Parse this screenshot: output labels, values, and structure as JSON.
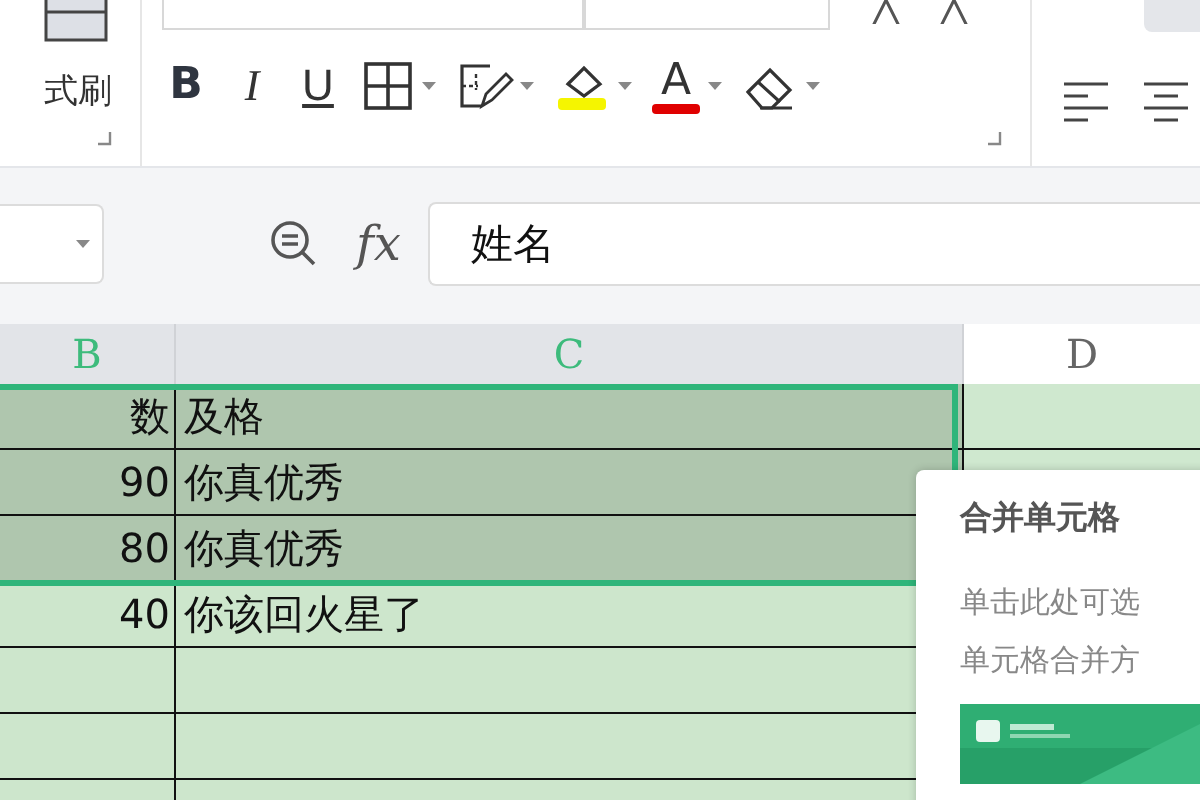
{
  "ribbon": {
    "format_painter": "式刷",
    "tools": [
      {
        "kind": "bold",
        "label": "B"
      },
      {
        "kind": "italic",
        "label": "I"
      },
      {
        "kind": "underline",
        "label": "U"
      },
      {
        "kind": "borders",
        "dropdown": true
      },
      {
        "kind": "cell-style",
        "dropdown": true
      },
      {
        "kind": "fill",
        "dropdown": true,
        "color": "#f5f500"
      },
      {
        "kind": "font-color",
        "label": "A",
        "dropdown": true,
        "color": "#e00000"
      },
      {
        "kind": "eraser",
        "dropdown": true
      },
      {
        "kind": "align-left"
      },
      {
        "kind": "align-center"
      }
    ]
  },
  "formula_bar": {
    "function_label": "fx",
    "value": "姓名"
  },
  "columns": [
    {
      "label": "B",
      "selected": true
    },
    {
      "label": "C",
      "selected": true
    },
    {
      "label": "D",
      "selected": false
    }
  ],
  "rows": [
    {
      "selected": true,
      "column_b": "数",
      "column_c": "及格"
    },
    {
      "selected": true,
      "column_b": "90",
      "column_c": "你真优秀"
    },
    {
      "selected": true,
      "column_b": "80",
      "column_c": "你真优秀"
    },
    {
      "selected": false,
      "column_b": "40",
      "column_c": "你该回火星了"
    },
    {
      "selected": false
    },
    {
      "selected": false
    },
    {
      "selected": false
    }
  ],
  "tooltip": {
    "title": "合并单元格",
    "lines": [
      "单击此处可选",
      "单元格合并方"
    ]
  }
}
